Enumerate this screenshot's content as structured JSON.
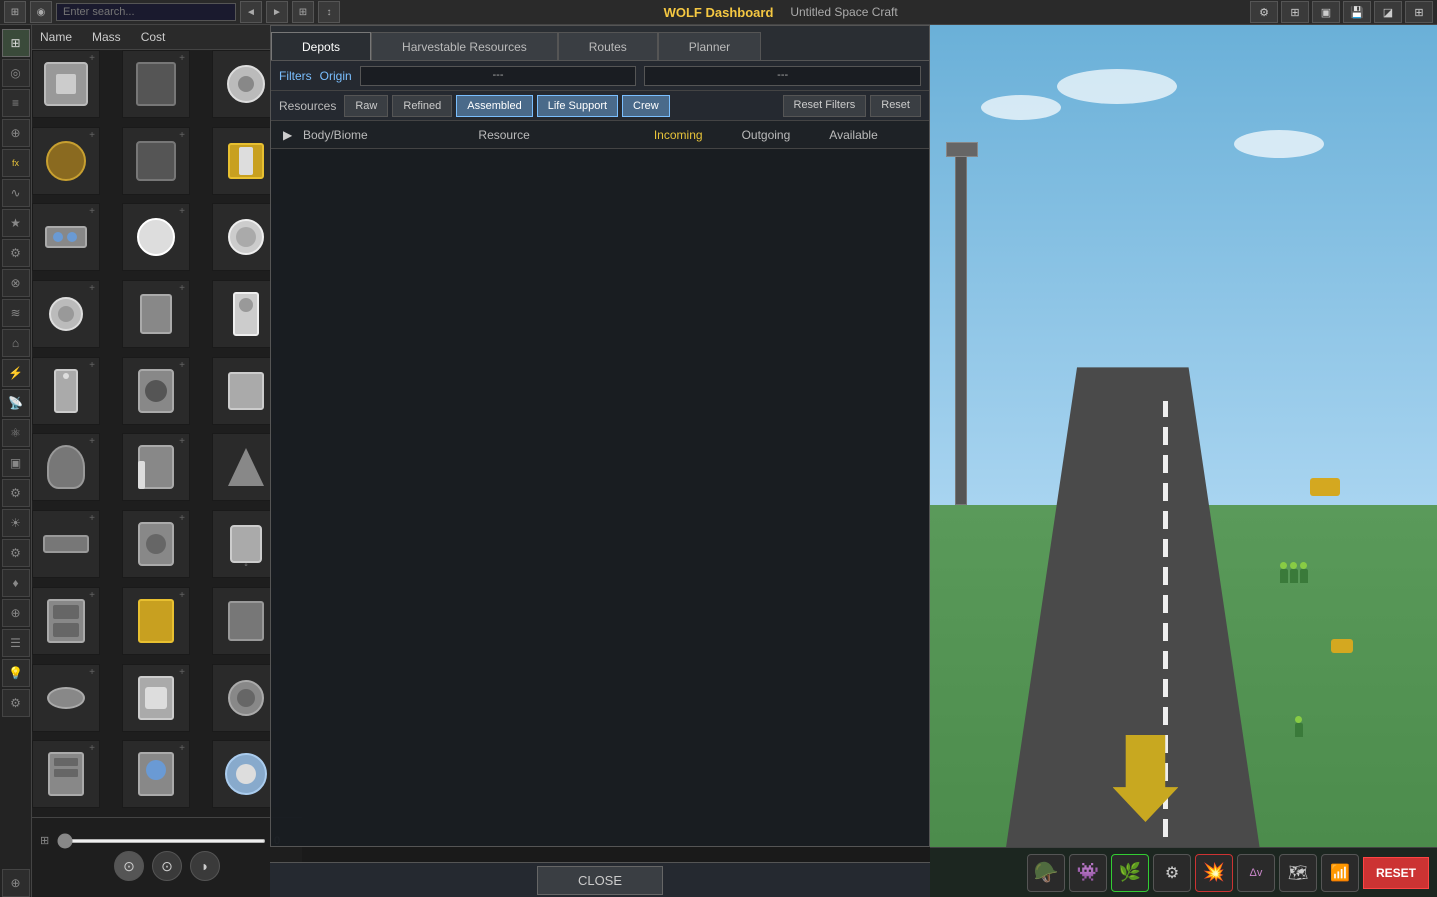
{
  "topbar": {
    "search_placeholder": "Enter search...",
    "wolf_title": "WOLF Dashboard",
    "craft_title": "Untitled Space Craft"
  },
  "parts_header": {
    "name_label": "Name",
    "mass_label": "Mass",
    "cost_label": "Cost"
  },
  "wolf": {
    "tabs": [
      {
        "id": "depots",
        "label": "Depots",
        "active": true
      },
      {
        "id": "harvestable",
        "label": "Harvestable Resources",
        "active": false
      },
      {
        "id": "routes",
        "label": "Routes",
        "active": false
      },
      {
        "id": "planner",
        "label": "Planner",
        "active": false
      }
    ],
    "filters_label": "Filters",
    "origin_label": "Origin",
    "dropdown1": "---",
    "dropdown2": "---",
    "resource_label": "Resources",
    "resource_buttons": [
      {
        "id": "raw",
        "label": "Raw",
        "active": false
      },
      {
        "id": "refined",
        "label": "Refined",
        "active": false
      },
      {
        "id": "assembled",
        "label": "Assembled",
        "active": true
      },
      {
        "id": "life_support",
        "label": "Life Support",
        "active": true
      },
      {
        "id": "crew",
        "label": "Crew",
        "active": true
      }
    ],
    "reset_filters_label": "Reset Filters",
    "reset_label": "Reset",
    "table": {
      "col_body_biome": "Body/Biome",
      "col_resource": "Resource",
      "col_incoming": "Incoming",
      "col_outgoing": "Outgoing",
      "col_available": "Available"
    },
    "close_label": "CLOSE"
  },
  "bottom_toolbar": {
    "reset_label": "RESET"
  },
  "slider": {
    "value": "0",
    "min": 0,
    "max": 100
  },
  "sidebar_icons": [
    "⊞",
    "◎",
    "≡",
    "⊕",
    "fx",
    "∿",
    "★",
    "⚙",
    "⊗",
    "≋",
    "⌂",
    "⚡",
    "📡",
    "⚛",
    "▣",
    "⚙",
    "☀",
    "⚙",
    "♦",
    "⊕",
    "☰",
    "💡",
    "⚙"
  ]
}
